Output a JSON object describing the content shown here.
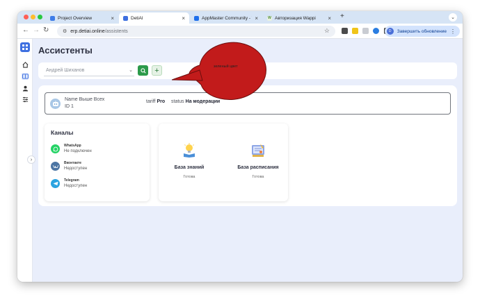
{
  "browser": {
    "tabs": [
      {
        "label": "Project Overview",
        "active": false
      },
      {
        "label": "DetiAI",
        "active": true
      },
      {
        "label": "AppMaster Community - Th",
        "active": false
      },
      {
        "label": "Авторизация Wappi",
        "active": false
      }
    ],
    "tab_close": "×",
    "new_tab": "+",
    "url_host": "erp.detiai.online",
    "url_path": "/assistents",
    "profile_initial": "D",
    "update_label": "Завершить обновление"
  },
  "page": {
    "title": "Ассистенты",
    "assistant_select_value": "Андрей Шиханов",
    "add_label": "+"
  },
  "assistant": {
    "name_label": "Name",
    "name_value": "Выше Всех",
    "id_label": "ID",
    "id_value": "1",
    "tariff_label": "tariff",
    "tariff_value": "Pro",
    "status_label": "status",
    "status_value": "На модерации"
  },
  "channels": {
    "title": "Каналы",
    "items": [
      {
        "name": "WhatsApp",
        "status": "Не подключен",
        "color": "#25d366"
      },
      {
        "name": "Вконтакте",
        "status": "Недоступен",
        "color": "#4c75a3"
      },
      {
        "name": "Telegram",
        "status": "Недоступен",
        "color": "#2aa3e0"
      }
    ]
  },
  "knowledge": [
    {
      "title": "База знаний",
      "status": "Готова"
    },
    {
      "title": "База расписания",
      "status": "Готова"
    }
  ],
  "annotation": {
    "text": "зеленый цвет"
  },
  "colors": {
    "accent": "#3d6fe0",
    "search_button": "#2c9a4a",
    "page_bg": "#e9eefb"
  }
}
